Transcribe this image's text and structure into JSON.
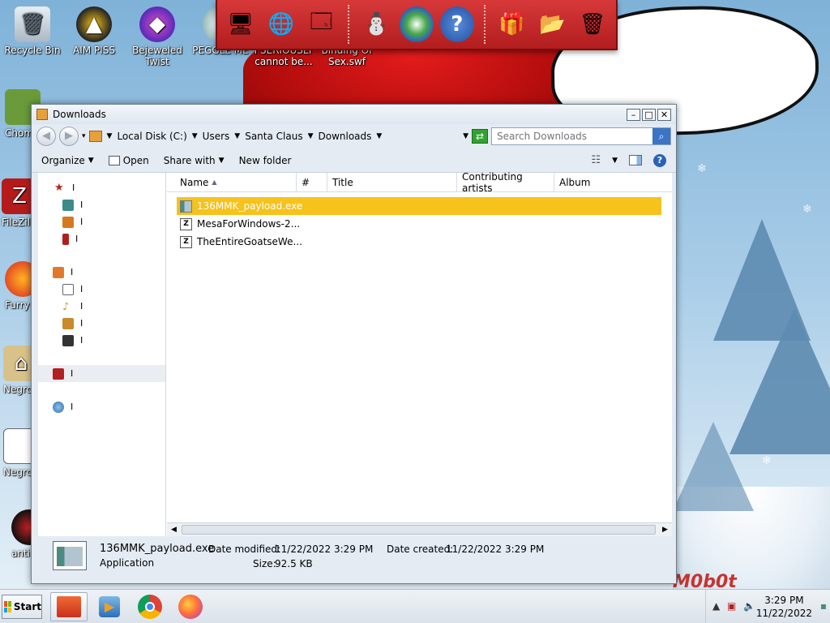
{
  "desktop": {
    "icons": [
      {
        "label": "Recycle Bin",
        "icon": "recycle-bin-icon"
      },
      {
        "label": "AIM PISS",
        "icon": "aim-icon"
      },
      {
        "label": "Bejeweled Twist",
        "icon": "bejeweled-icon"
      },
      {
        "label": "PEGGLE ME",
        "icon": "peggle-icon"
      },
      {
        "label": "I SERIOUSLY cannot be...",
        "icon": "document-icon"
      },
      {
        "label": "Binding Of Sex.swf",
        "icon": "flash-icon"
      },
      {
        "label": "Chom",
        "icon": "app-icon"
      },
      {
        "label": "FileZill",
        "icon": "filezilla-icon"
      },
      {
        "label": "Furry",
        "icon": "firefox-icon"
      },
      {
        "label": "Negro",
        "icon": "house-icon"
      },
      {
        "label": "Negro",
        "icon": "notepad-icon"
      },
      {
        "label": "anti",
        "icon": "app-icon"
      }
    ],
    "watermark_text": "M0b0t",
    "colors": {
      "sky": "#7fb2d8",
      "wall_red": "#c71414",
      "speech_text": "#c0363d"
    }
  },
  "dock": {
    "items": [
      "santa-computer-icon",
      "globe-network-icon",
      "control-panel-icon",
      "snowman-icon",
      "windows-logo-icon",
      "help-icon",
      "gift-icon",
      "folder-icon",
      "recycle-bin-icon"
    ]
  },
  "window": {
    "title": "Downloads",
    "controls": {
      "minimize": "–",
      "maximize": "□",
      "close": "✕"
    },
    "breadcrumb": [
      "Local Disk (C:)",
      "Users",
      "Santa Claus",
      "Downloads"
    ],
    "search_placeholder": "Search Downloads",
    "toolbar": {
      "organize": "Organize",
      "open": "Open",
      "share_with": "Share with",
      "new_folder": "New folder"
    },
    "columns": [
      "Name",
      "#",
      "Title",
      "Contributing artists",
      "Album"
    ],
    "files": [
      {
        "name": "136MMK_payload.exe",
        "icon": "application-icon",
        "selected": true
      },
      {
        "name": "MesaForWindows-2...",
        "icon": "archive-icon",
        "selected": false
      },
      {
        "name": "TheEntireGoatseWe...",
        "icon": "archive-icon",
        "selected": false
      }
    ],
    "nav_marker": "I",
    "details": {
      "filename": "136MMK_payload.exe",
      "type": "Application",
      "date_modified_label": "Date modified:",
      "date_modified": "11/22/2022 3:29 PM",
      "date_created_label": "Date created:",
      "date_created": "11/22/2022 3:29 PM",
      "size_label": "Size:",
      "size": "92.5 KB"
    },
    "colors": {
      "selection": "#f6c21b",
      "chrome": "#e4ebf3"
    }
  },
  "taskbar": {
    "start_label": "Start",
    "apps": [
      "explorer-icon",
      "media-player-icon",
      "chrome-icon",
      "firefox-icon"
    ],
    "clock_time": "3:29 PM",
    "clock_date": "11/22/2022"
  }
}
